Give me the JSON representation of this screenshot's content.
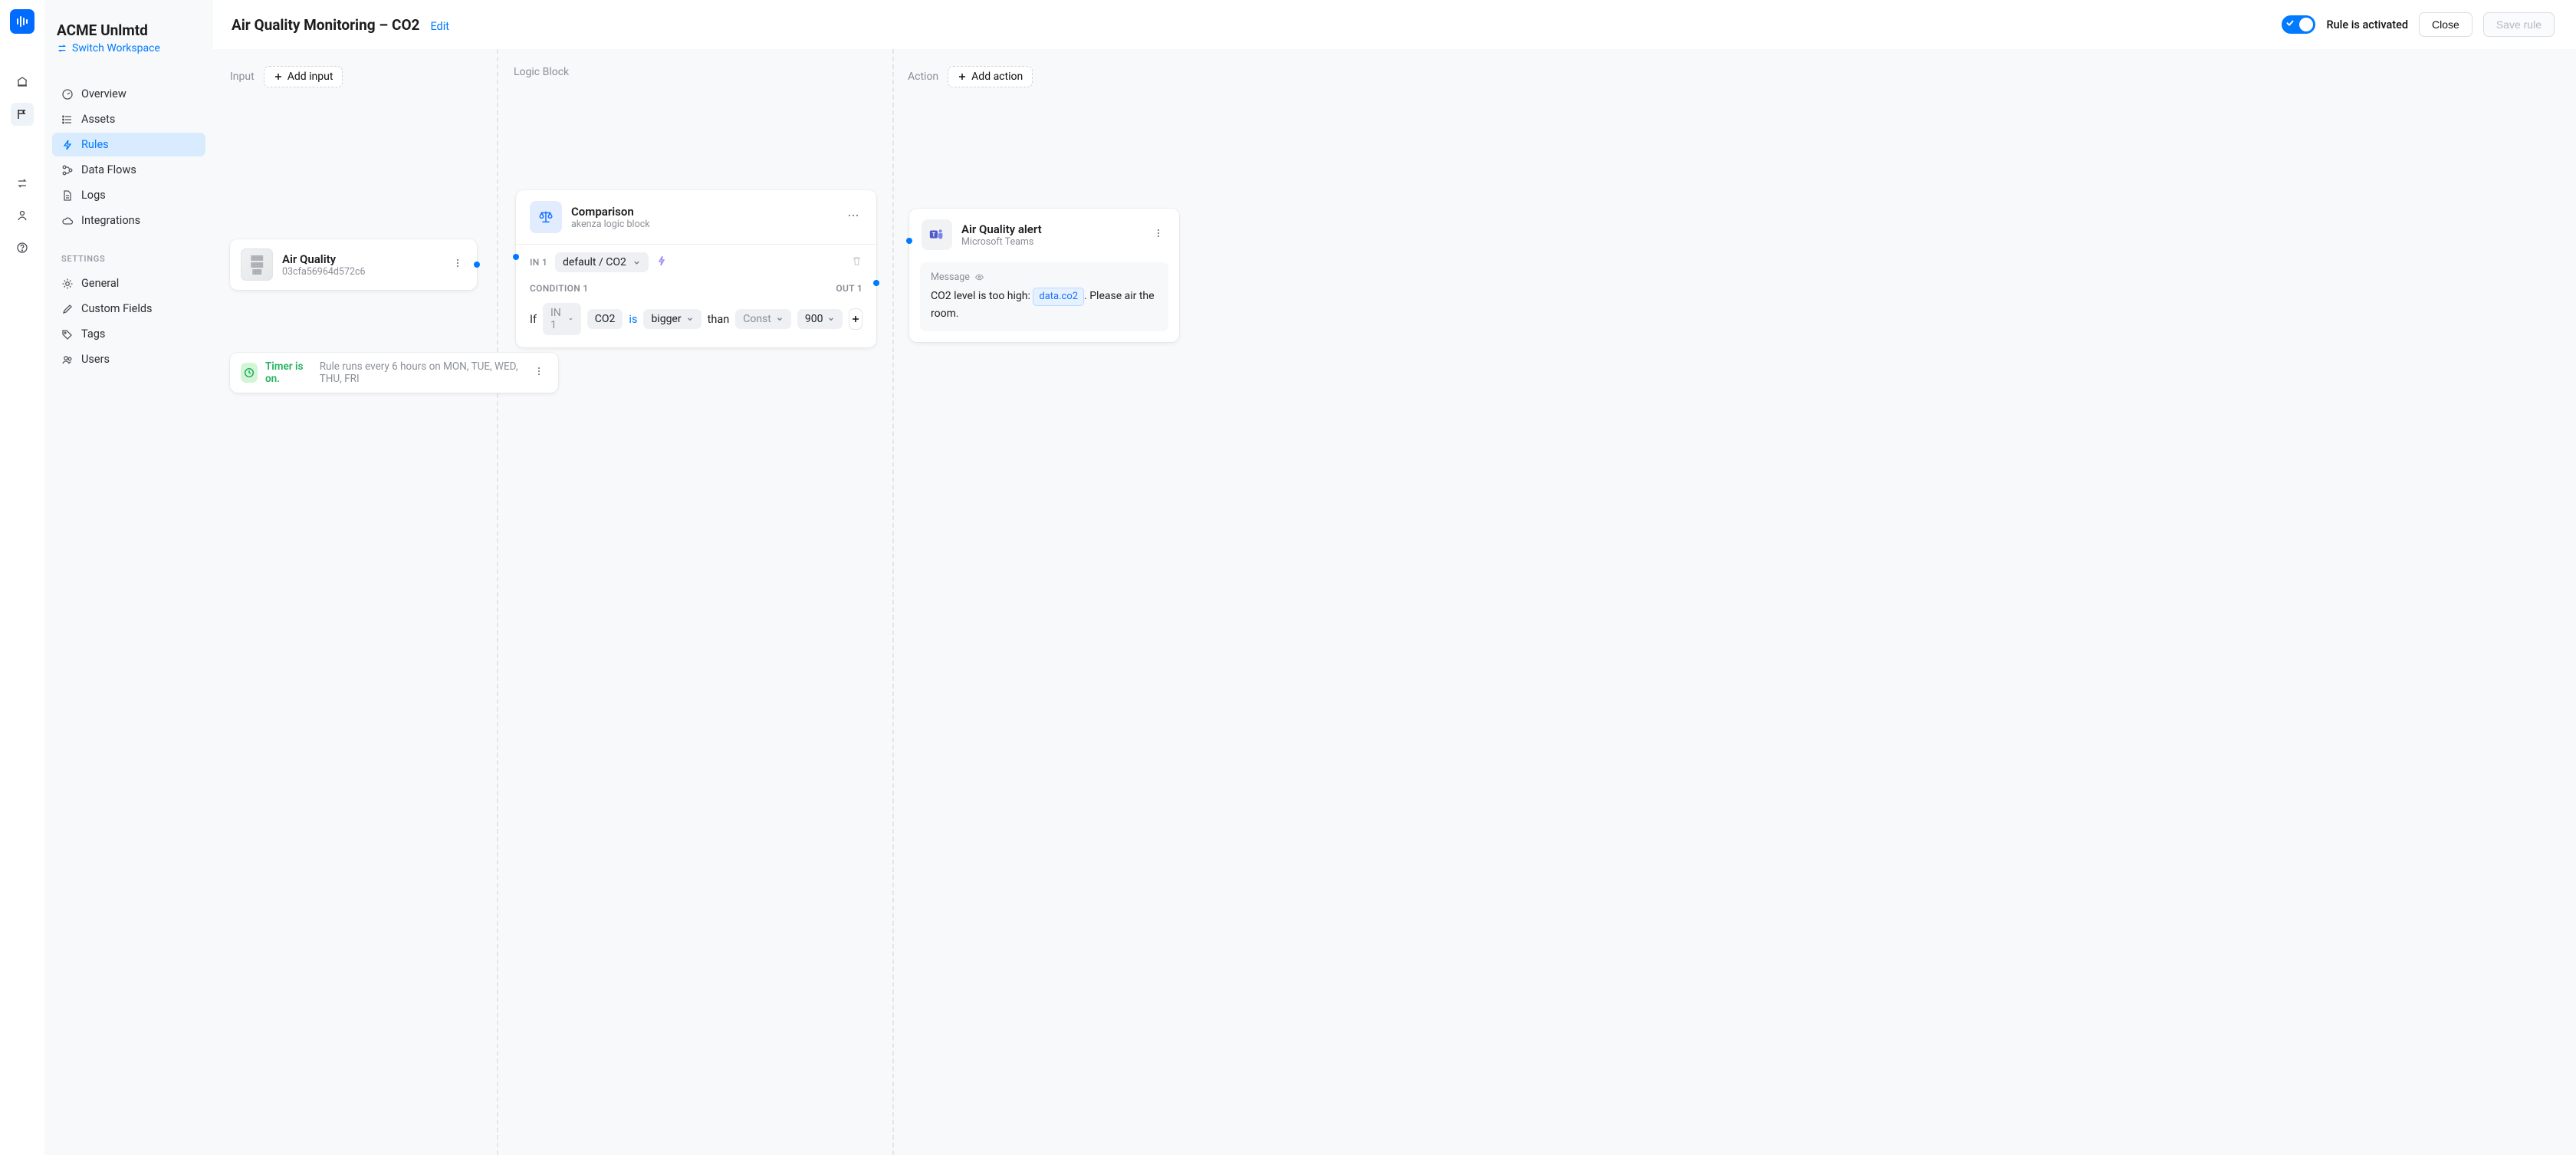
{
  "workspace": {
    "name": "ACME Unlmtd",
    "switch_label": "Switch Workspace"
  },
  "nav": {
    "items": [
      "Overview",
      "Assets",
      "Rules",
      "Data Flows",
      "Logs",
      "Integrations"
    ],
    "active": "Rules",
    "settings_heading": "SETTINGS",
    "settings_items": [
      "General",
      "Custom Fields",
      "Tags",
      "Users"
    ]
  },
  "page": {
    "title": "Air Quality Monitoring – CO2",
    "edit_label": "Edit",
    "toggle_label": "Rule is activated",
    "close_label": "Close",
    "save_label": "Save rule"
  },
  "columns": {
    "input": "Input",
    "add_input": "Add input",
    "logic": "Logic Block",
    "action": "Action",
    "add_action": "Add action"
  },
  "input_node": {
    "title": "Air Quality",
    "id": "03cfa56964d572c6"
  },
  "timer": {
    "on_label": "Timer is on.",
    "desc": "Rule runs every 6 hours on MON, TUE, WED, THU, FRI"
  },
  "logic_node": {
    "title": "Comparison",
    "subtitle": "akenza logic block",
    "in_label": "IN 1",
    "in_value": "default / CO2",
    "condition_label": "CONDITION 1",
    "out_label": "OUT 1",
    "if_label": "If",
    "src_sel": "IN 1",
    "field": "CO2",
    "is_label": "is",
    "op": "bigger",
    "than_label": "than",
    "rhs_type": "Const",
    "rhs_value": "900"
  },
  "action_node": {
    "title": "Air Quality alert",
    "subtitle": "Microsoft Teams",
    "message_label": "Message",
    "message_pre": "CO2 level is too high: ",
    "message_var": "data.co2",
    "message_post": ". Please air the room."
  }
}
